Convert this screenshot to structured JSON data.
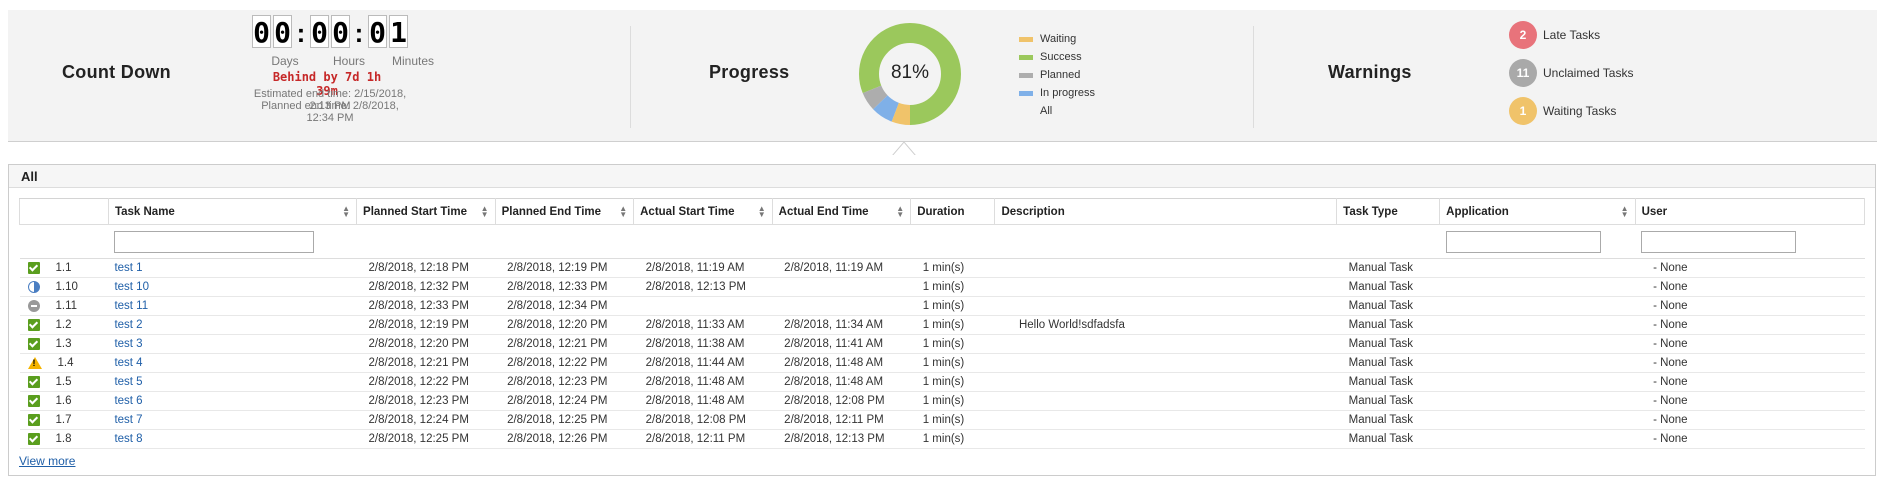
{
  "countdown": {
    "title": "Count Down",
    "digits": [
      "0",
      "0",
      "0",
      "0",
      "0",
      "1"
    ],
    "separator": ":",
    "units": [
      "Days",
      "Hours",
      "Minutes"
    ],
    "behind": "Behind by 7d 1h 39m",
    "estimated_end": "Estimated end time: 2/15/2018, 2:13 PM",
    "planned_end": "Planned end time: 2/8/2018, 12:34 PM"
  },
  "progress": {
    "title": "Progress",
    "percent_label": "81%",
    "legend": [
      {
        "label": "Waiting",
        "color": "#f0c36a"
      },
      {
        "label": "Success",
        "color": "#9bc85c"
      },
      {
        "label": "Planned",
        "color": "#adadad"
      },
      {
        "label": "In progress",
        "color": "#7fb0e8"
      },
      {
        "label": "All",
        "color": ""
      }
    ],
    "segments": [
      {
        "label": "Success",
        "fraction": 0.81,
        "color": "#9bc85c"
      },
      {
        "label": "Planned",
        "fraction": 0.06,
        "color": "#adadad"
      },
      {
        "label": "In progress",
        "fraction": 0.07,
        "color": "#7fb0e8"
      },
      {
        "label": "Waiting",
        "fraction": 0.06,
        "color": "#f0c36a"
      }
    ]
  },
  "warnings": {
    "title": "Warnings",
    "items": [
      {
        "count": "2",
        "label": "Late Tasks",
        "color": "#e8737b"
      },
      {
        "count": "11",
        "label": "Unclaimed Tasks",
        "color": "#a9a9a9"
      },
      {
        "count": "1",
        "label": "Waiting Tasks",
        "color": "#f0c36a"
      }
    ]
  },
  "panel": {
    "title": "All",
    "view_more": "View more"
  },
  "table": {
    "headers": [
      "",
      "Task Name",
      "Planned Start Time",
      "Planned End Time",
      "Actual Start Time",
      "Actual End Time",
      "Duration",
      "Description",
      "Task Type",
      "Application",
      "User"
    ],
    "rows": [
      {
        "status": "success",
        "id": "1.1",
        "name": "test 1",
        "pstart": "2/8/2018, 12:18 PM",
        "pend": "2/8/2018, 12:19 PM",
        "astart": "2/8/2018, 11:19 AM",
        "aend": "2/8/2018, 11:19 AM",
        "duration": "1 min(s)",
        "desc": "",
        "type": "Manual Task",
        "app": "",
        "user": "- None"
      },
      {
        "status": "progress",
        "id": "1.10",
        "name": "test 10",
        "pstart": "2/8/2018, 12:32 PM",
        "pend": "2/8/2018, 12:33 PM",
        "astart": "2/8/2018, 12:13 PM",
        "aend": "",
        "duration": "1 min(s)",
        "desc": "",
        "type": "Manual Task",
        "app": "",
        "user": "- None"
      },
      {
        "status": "planned",
        "id": "1.11",
        "name": "test 11",
        "pstart": "2/8/2018, 12:33 PM",
        "pend": "2/8/2018, 12:34 PM",
        "astart": "",
        "aend": "",
        "duration": "1 min(s)",
        "desc": "",
        "type": "Manual Task",
        "app": "",
        "user": "- None"
      },
      {
        "status": "success",
        "id": "1.2",
        "name": "test 2",
        "pstart": "2/8/2018, 12:19 PM",
        "pend": "2/8/2018, 12:20 PM",
        "astart": "2/8/2018, 11:33 AM",
        "aend": "2/8/2018, 11:34 AM",
        "duration": "1 min(s)",
        "desc": "Hello World!sdfadsfa",
        "type": "Manual Task",
        "app": "",
        "user": "- None"
      },
      {
        "status": "success",
        "id": "1.3",
        "name": "test 3",
        "pstart": "2/8/2018, 12:20 PM",
        "pend": "2/8/2018, 12:21 PM",
        "astart": "2/8/2018, 11:38 AM",
        "aend": "2/8/2018, 11:41 AM",
        "duration": "1 min(s)",
        "desc": "",
        "type": "Manual Task",
        "app": "",
        "user": "- None"
      },
      {
        "status": "warning",
        "id": "1.4",
        "name": "test 4",
        "pstart": "2/8/2018, 12:21 PM",
        "pend": "2/8/2018, 12:22 PM",
        "astart": "2/8/2018, 11:44 AM",
        "aend": "2/8/2018, 11:48 AM",
        "duration": "1 min(s)",
        "desc": "",
        "type": "Manual Task",
        "app": "",
        "user": "- None"
      },
      {
        "status": "success",
        "id": "1.5",
        "name": "test 5",
        "pstart": "2/8/2018, 12:22 PM",
        "pend": "2/8/2018, 12:23 PM",
        "astart": "2/8/2018, 11:48 AM",
        "aend": "2/8/2018, 11:48 AM",
        "duration": "1 min(s)",
        "desc": "",
        "type": "Manual Task",
        "app": "",
        "user": "- None"
      },
      {
        "status": "success",
        "id": "1.6",
        "name": "test 6",
        "pstart": "2/8/2018, 12:23 PM",
        "pend": "2/8/2018, 12:24 PM",
        "astart": "2/8/2018, 11:48 AM",
        "aend": "2/8/2018, 12:08 PM",
        "duration": "1 min(s)",
        "desc": "",
        "type": "Manual Task",
        "app": "",
        "user": "- None"
      },
      {
        "status": "success",
        "id": "1.7",
        "name": "test 7",
        "pstart": "2/8/2018, 12:24 PM",
        "pend": "2/8/2018, 12:25 PM",
        "astart": "2/8/2018, 12:08 PM",
        "aend": "2/8/2018, 12:11 PM",
        "duration": "1 min(s)",
        "desc": "",
        "type": "Manual Task",
        "app": "",
        "user": "- None"
      },
      {
        "status": "success",
        "id": "1.8",
        "name": "test 8",
        "pstart": "2/8/2018, 12:25 PM",
        "pend": "2/8/2018, 12:26 PM",
        "astart": "2/8/2018, 12:11 PM",
        "aend": "2/8/2018, 12:13 PM",
        "duration": "1 min(s)",
        "desc": "",
        "type": "Manual Task",
        "app": "",
        "user": "- None"
      }
    ]
  }
}
